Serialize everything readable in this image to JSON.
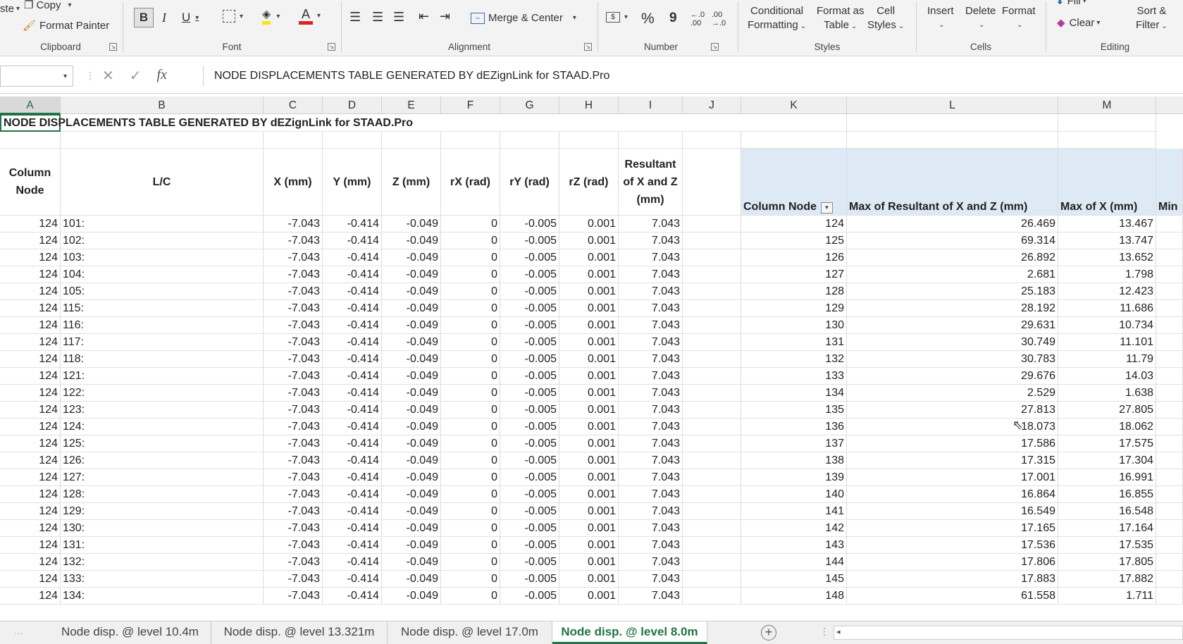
{
  "ribbon": {
    "clipboard": {
      "paste_label": "ste",
      "copy_label": "Copy",
      "format_painter_label": "Format Painter",
      "group_label": "Clipboard"
    },
    "font": {
      "bold": "B",
      "italic": "I",
      "underline": "U",
      "font_color_glyph": "A",
      "group_label": "Font"
    },
    "alignment": {
      "merge_center_label": "Merge & Center",
      "group_label": "Alignment"
    },
    "number": {
      "percent": "%",
      "comma": "9",
      "group_label": "Number"
    },
    "styles": {
      "conditional_line1": "Conditional",
      "conditional_line2": "Formatting",
      "format_table_line1": "Format as",
      "format_table_line2": "Table",
      "cell_styles_line1": "Cell",
      "cell_styles_line2": "Styles",
      "group_label": "Styles"
    },
    "cells": {
      "insert_label": "Insert",
      "delete_label": "Delete",
      "format_label": "Format",
      "group_label": "Cells"
    },
    "editing": {
      "fill_label": "Fill",
      "clear_label": "Clear",
      "sort_line1": "Sort &",
      "sort_line2": "Filter",
      "group_label": "Editing"
    }
  },
  "formula_bar": {
    "name_box": "",
    "fx": "fx",
    "content": "NODE DISPLACEMENTS TABLE GENERATED BY dEZignLink for STAAD.Pro"
  },
  "columns": [
    "A",
    "B",
    "C",
    "D",
    "E",
    "F",
    "G",
    "H",
    "I",
    "J",
    "K",
    "L",
    "M"
  ],
  "sheet": {
    "title": "NODE DISPLACEMENTS TABLE GENERATED BY dEZignLink for STAAD.Pro",
    "headers": {
      "column_node": "Column Node",
      "lc": "L/C",
      "x": "X (mm)",
      "y": "Y (mm)",
      "z": "Z (mm)",
      "rx": "rX (rad)",
      "ry": "rY (rad)",
      "rz": "rZ (rad)",
      "resultant": "Resultant of X and Z (mm)"
    },
    "rows": [
      [
        "124",
        "101:",
        "-7.043",
        "-0.414",
        "-0.049",
        "0",
        "-0.005",
        "0.001",
        "7.043"
      ],
      [
        "124",
        "102:",
        "-7.043",
        "-0.414",
        "-0.049",
        "0",
        "-0.005",
        "0.001",
        "7.043"
      ],
      [
        "124",
        "103:",
        "-7.043",
        "-0.414",
        "-0.049",
        "0",
        "-0.005",
        "0.001",
        "7.043"
      ],
      [
        "124",
        "104:",
        "-7.043",
        "-0.414",
        "-0.049",
        "0",
        "-0.005",
        "0.001",
        "7.043"
      ],
      [
        "124",
        "105:",
        "-7.043",
        "-0.414",
        "-0.049",
        "0",
        "-0.005",
        "0.001",
        "7.043"
      ],
      [
        "124",
        "115:",
        "-7.043",
        "-0.414",
        "-0.049",
        "0",
        "-0.005",
        "0.001",
        "7.043"
      ],
      [
        "124",
        "116:",
        "-7.043",
        "-0.414",
        "-0.049",
        "0",
        "-0.005",
        "0.001",
        "7.043"
      ],
      [
        "124",
        "117:",
        "-7.043",
        "-0.414",
        "-0.049",
        "0",
        "-0.005",
        "0.001",
        "7.043"
      ],
      [
        "124",
        "118:",
        "-7.043",
        "-0.414",
        "-0.049",
        "0",
        "-0.005",
        "0.001",
        "7.043"
      ],
      [
        "124",
        "121:",
        "-7.043",
        "-0.414",
        "-0.049",
        "0",
        "-0.005",
        "0.001",
        "7.043"
      ],
      [
        "124",
        "122:",
        "-7.043",
        "-0.414",
        "-0.049",
        "0",
        "-0.005",
        "0.001",
        "7.043"
      ],
      [
        "124",
        "123:",
        "-7.043",
        "-0.414",
        "-0.049",
        "0",
        "-0.005",
        "0.001",
        "7.043"
      ],
      [
        "124",
        "124:",
        "-7.043",
        "-0.414",
        "-0.049",
        "0",
        "-0.005",
        "0.001",
        "7.043"
      ],
      [
        "124",
        "125:",
        "-7.043",
        "-0.414",
        "-0.049",
        "0",
        "-0.005",
        "0.001",
        "7.043"
      ],
      [
        "124",
        "126:",
        "-7.043",
        "-0.414",
        "-0.049",
        "0",
        "-0.005",
        "0.001",
        "7.043"
      ],
      [
        "124",
        "127:",
        "-7.043",
        "-0.414",
        "-0.049",
        "0",
        "-0.005",
        "0.001",
        "7.043"
      ],
      [
        "124",
        "128:",
        "-7.043",
        "-0.414",
        "-0.049",
        "0",
        "-0.005",
        "0.001",
        "7.043"
      ],
      [
        "124",
        "129:",
        "-7.043",
        "-0.414",
        "-0.049",
        "0",
        "-0.005",
        "0.001",
        "7.043"
      ],
      [
        "124",
        "130:",
        "-7.043",
        "-0.414",
        "-0.049",
        "0",
        "-0.005",
        "0.001",
        "7.043"
      ],
      [
        "124",
        "131:",
        "-7.043",
        "-0.414",
        "-0.049",
        "0",
        "-0.005",
        "0.001",
        "7.043"
      ],
      [
        "124",
        "132:",
        "-7.043",
        "-0.414",
        "-0.049",
        "0",
        "-0.005",
        "0.001",
        "7.043"
      ],
      [
        "124",
        "133:",
        "-7.043",
        "-0.414",
        "-0.049",
        "0",
        "-0.005",
        "0.001",
        "7.043"
      ],
      [
        "124",
        "134:",
        "-7.043",
        "-0.414",
        "-0.049",
        "0",
        "-0.005",
        "0.001",
        "7.043"
      ]
    ]
  },
  "pivot": {
    "headers": {
      "column_node": "Column Node",
      "max_resultant": "Max of Resultant of X and Z (mm)",
      "max_x": "Max of X (mm)",
      "min": "Min"
    },
    "rows": [
      [
        "124",
        "26.469",
        "13.467"
      ],
      [
        "125",
        "69.314",
        "13.747"
      ],
      [
        "126",
        "26.892",
        "13.652"
      ],
      [
        "127",
        "2.681",
        "1.798"
      ],
      [
        "128",
        "25.183",
        "12.423"
      ],
      [
        "129",
        "28.192",
        "11.686"
      ],
      [
        "130",
        "29.631",
        "10.734"
      ],
      [
        "131",
        "30.749",
        "11.101"
      ],
      [
        "132",
        "30.783",
        "11.79"
      ],
      [
        "133",
        "29.676",
        "14.03"
      ],
      [
        "134",
        "2.529",
        "1.638"
      ],
      [
        "135",
        "27.813",
        "27.805"
      ],
      [
        "136",
        "18.073",
        "18.062"
      ],
      [
        "137",
        "17.586",
        "17.575"
      ],
      [
        "138",
        "17.315",
        "17.304"
      ],
      [
        "139",
        "17.001",
        "16.991"
      ],
      [
        "140",
        "16.864",
        "16.855"
      ],
      [
        "141",
        "16.549",
        "16.548"
      ],
      [
        "142",
        "17.165",
        "17.164"
      ],
      [
        "143",
        "17.536",
        "17.535"
      ],
      [
        "144",
        "17.806",
        "17.805"
      ],
      [
        "145",
        "17.883",
        "17.882"
      ],
      [
        "148",
        "61.558",
        "1.711"
      ]
    ]
  },
  "tabs": [
    {
      "label": "Node disp. @ level 10.4m",
      "active": false
    },
    {
      "label": "Node disp. @ level 13.321m",
      "active": false
    },
    {
      "label": "Node disp. @ level 17.0m",
      "active": false
    },
    {
      "label": "Node disp. @ level 8.0m",
      "active": true
    }
  ],
  "colors": {
    "excel_green": "#217346",
    "pivot_fill": "#dde9f5",
    "font_color_bar": "#e02020",
    "highlight_bar": "#ffe600"
  },
  "icons": [
    "copy-icon",
    "format-painter-icon",
    "bold-icon",
    "italic-icon",
    "underline-icon",
    "borders-icon",
    "fill-color-icon",
    "font-color-icon",
    "align-left-icon",
    "align-center-icon",
    "align-right-icon",
    "decrease-indent-icon",
    "increase-indent-icon",
    "merge-icon",
    "accounting-format-icon",
    "percent-icon",
    "comma-icon",
    "increase-decimal-icon",
    "decrease-decimal-icon",
    "fill-icon",
    "clear-icon",
    "cancel-icon",
    "enter-icon",
    "fx-icon",
    "filter-dropdown-icon",
    "add-sheet-icon",
    "mouse-cursor-icon"
  ]
}
